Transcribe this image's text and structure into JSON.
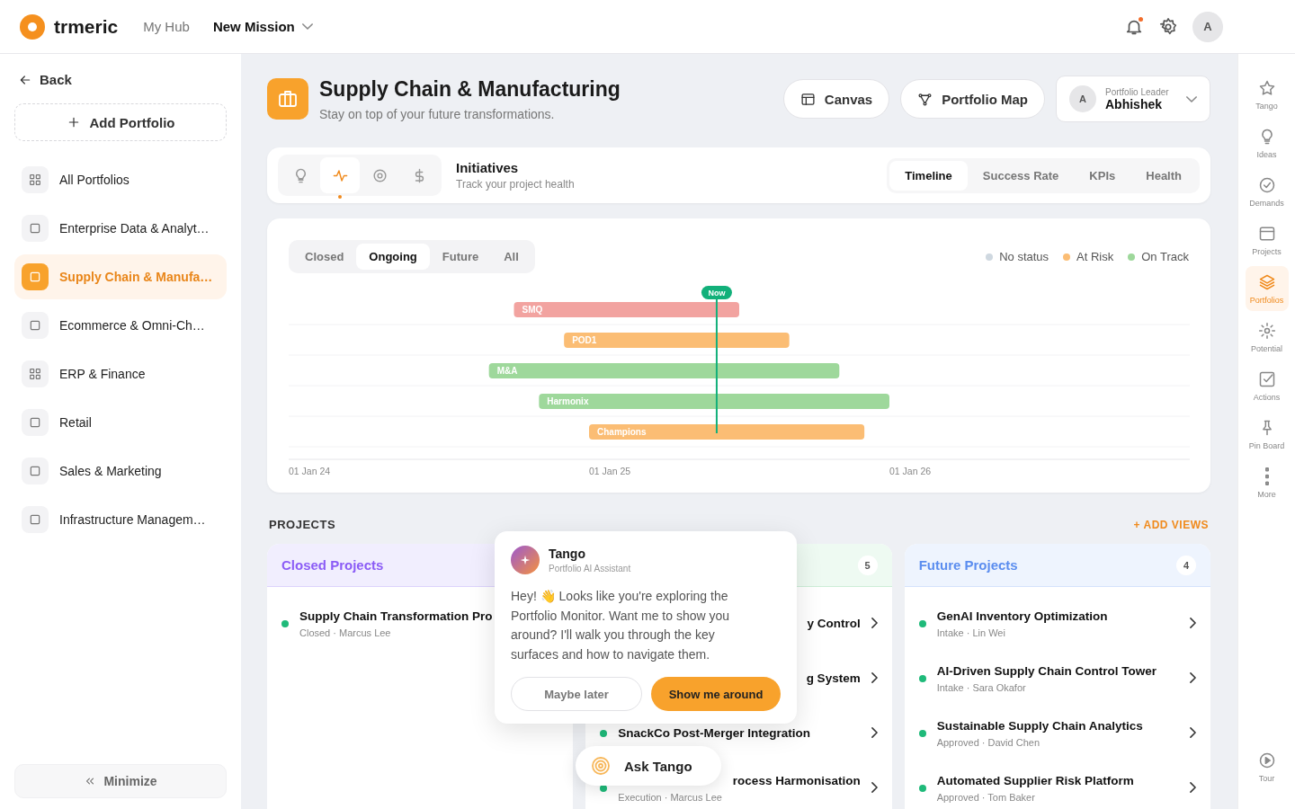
{
  "topbar": {
    "brand": "trmeric",
    "nav": [
      {
        "label": "My Hub",
        "selected": false,
        "dropdown": false
      },
      {
        "label": "New Mission",
        "selected": true,
        "dropdown": true
      }
    ],
    "notifications_unread": true,
    "avatar": "A"
  },
  "sidebar": {
    "back": "Back",
    "add_button": "Add Portfolio",
    "items": [
      {
        "label": "All Portfolios",
        "kind": "grid",
        "selected": false
      },
      {
        "label": "Enterprise Data & Analyt…",
        "kind": "square",
        "selected": false
      },
      {
        "label": "Supply Chain & Manufa…",
        "kind": "square",
        "selected": true
      },
      {
        "label": "Ecommerce & Omni-Ch…",
        "kind": "square",
        "selected": false
      },
      {
        "label": "ERP & Finance",
        "kind": "grid",
        "selected": false
      },
      {
        "label": "Retail",
        "kind": "square",
        "selected": false
      },
      {
        "label": "Sales & Marketing",
        "kind": "square",
        "selected": false
      },
      {
        "label": "Infrastructure Managem…",
        "kind": "square",
        "selected": false
      }
    ],
    "minimize": "Minimize"
  },
  "header": {
    "title": "Supply Chain & Manufacturing",
    "subtitle": "Stay on top of your future transformations.",
    "buttons": [
      {
        "label": "Canvas",
        "kind": "canvas"
      },
      {
        "label": "Portfolio Map",
        "kind": "map"
      }
    ],
    "leader": {
      "role": "Portfolio Leader",
      "name": "Abhishek",
      "avatar": "A"
    }
  },
  "initiatives": {
    "icon_tabs": [
      {
        "kind": "bulb",
        "selected": false
      },
      {
        "kind": "pulse",
        "selected": true
      },
      {
        "kind": "target",
        "selected": false
      },
      {
        "kind": "dollar",
        "selected": false
      }
    ],
    "title": "Initiatives",
    "subtitle": "Track your project health",
    "view_tabs": [
      {
        "label": "Timeline",
        "selected": true
      },
      {
        "label": "Success Rate",
        "selected": false
      },
      {
        "label": "KPIs",
        "selected": false
      },
      {
        "label": "Health",
        "selected": false
      }
    ]
  },
  "timeline": {
    "filters": [
      {
        "label": "Closed",
        "selected": false
      },
      {
        "label": "Ongoing",
        "selected": true
      },
      {
        "label": "Future",
        "selected": false
      },
      {
        "label": "All",
        "selected": false
      }
    ],
    "legend": [
      {
        "label": "No status",
        "color": "#cfd8e0"
      },
      {
        "label": "At Risk",
        "color": "#fbbd74"
      },
      {
        "label": "On Track",
        "color": "#9ed89b"
      }
    ],
    "bars": [
      {
        "label": "SMQ",
        "color": "#f2a3a0"
      },
      {
        "label": "POD1",
        "color": "#fbbd74"
      },
      {
        "label": "M&A",
        "color": "#9ed89b"
      },
      {
        "label": "Harmonix",
        "color": "#9ed89b"
      },
      {
        "label": "Champions",
        "color": "#fbbd74"
      }
    ],
    "axis_labels": [
      "01 Jan 24",
      "01 Jan 25",
      "01 Jan 26"
    ],
    "now_label": "Now"
  },
  "projects": {
    "heading": "PROJECTS",
    "add_views": "+ ADD VIEWS",
    "columns": [
      {
        "title": "Closed Projects",
        "kind": "closed",
        "items": [
          {
            "title": "Supply Chain Transformation Pro",
            "sub": "Closed · Marcus Lee"
          }
        ]
      },
      {
        "count": "5",
        "kind": "ongoing",
        "items": [
          {
            "title": "y Control",
            "clipped": true
          },
          {
            "title": "g System",
            "clipped": true
          },
          {
            "title": "SnackCo Post-Merger Integration"
          },
          {
            "title": "rocess Harmonisation",
            "sub": "Execution · Marcus Lee",
            "clipped": true
          }
        ]
      },
      {
        "title": "Future Projects",
        "count": "4",
        "kind": "future",
        "items": [
          {
            "title": "GenAI Inventory Optimization",
            "sub": "Intake · Lin Wei"
          },
          {
            "title": "AI-Driven Supply Chain Control Tower",
            "sub": "Intake · Sara Okafor"
          },
          {
            "title": "Sustainable Supply Chain Analytics",
            "sub": "Approved · David Chen"
          },
          {
            "title": "Automated Supplier Risk Platform",
            "sub": "Approved · Tom Baker"
          }
        ]
      }
    ]
  },
  "assistant": {
    "name": "Tango",
    "role": "Portfolio AI Assistant",
    "message": "Hey! 👋 Looks like you're exploring the Portfolio Monitor. Want me to show you around? I'll walk you through the key surfaces and how to navigate them.",
    "secondary": "Maybe later",
    "primary": "Show me around",
    "ask": "Ask Tango"
  },
  "rail": {
    "items": [
      {
        "label": "Tango",
        "kind": "star",
        "selected": false
      },
      {
        "label": "Ideas",
        "kind": "bulb",
        "selected": false
      },
      {
        "label": "Demands",
        "kind": "check",
        "selected": false
      },
      {
        "label": "Projects",
        "kind": "window",
        "selected": false
      },
      {
        "label": "Portfolios",
        "kind": "layers",
        "selected": true
      },
      {
        "label": "Potential",
        "kind": "sun",
        "selected": false
      },
      {
        "label": "Actions",
        "kind": "edit",
        "selected": false
      },
      {
        "label": "Pin Board",
        "kind": "pin",
        "selected": false
      },
      {
        "label": "More",
        "kind": "dots",
        "selected": false
      }
    ],
    "tour": "Tour"
  }
}
